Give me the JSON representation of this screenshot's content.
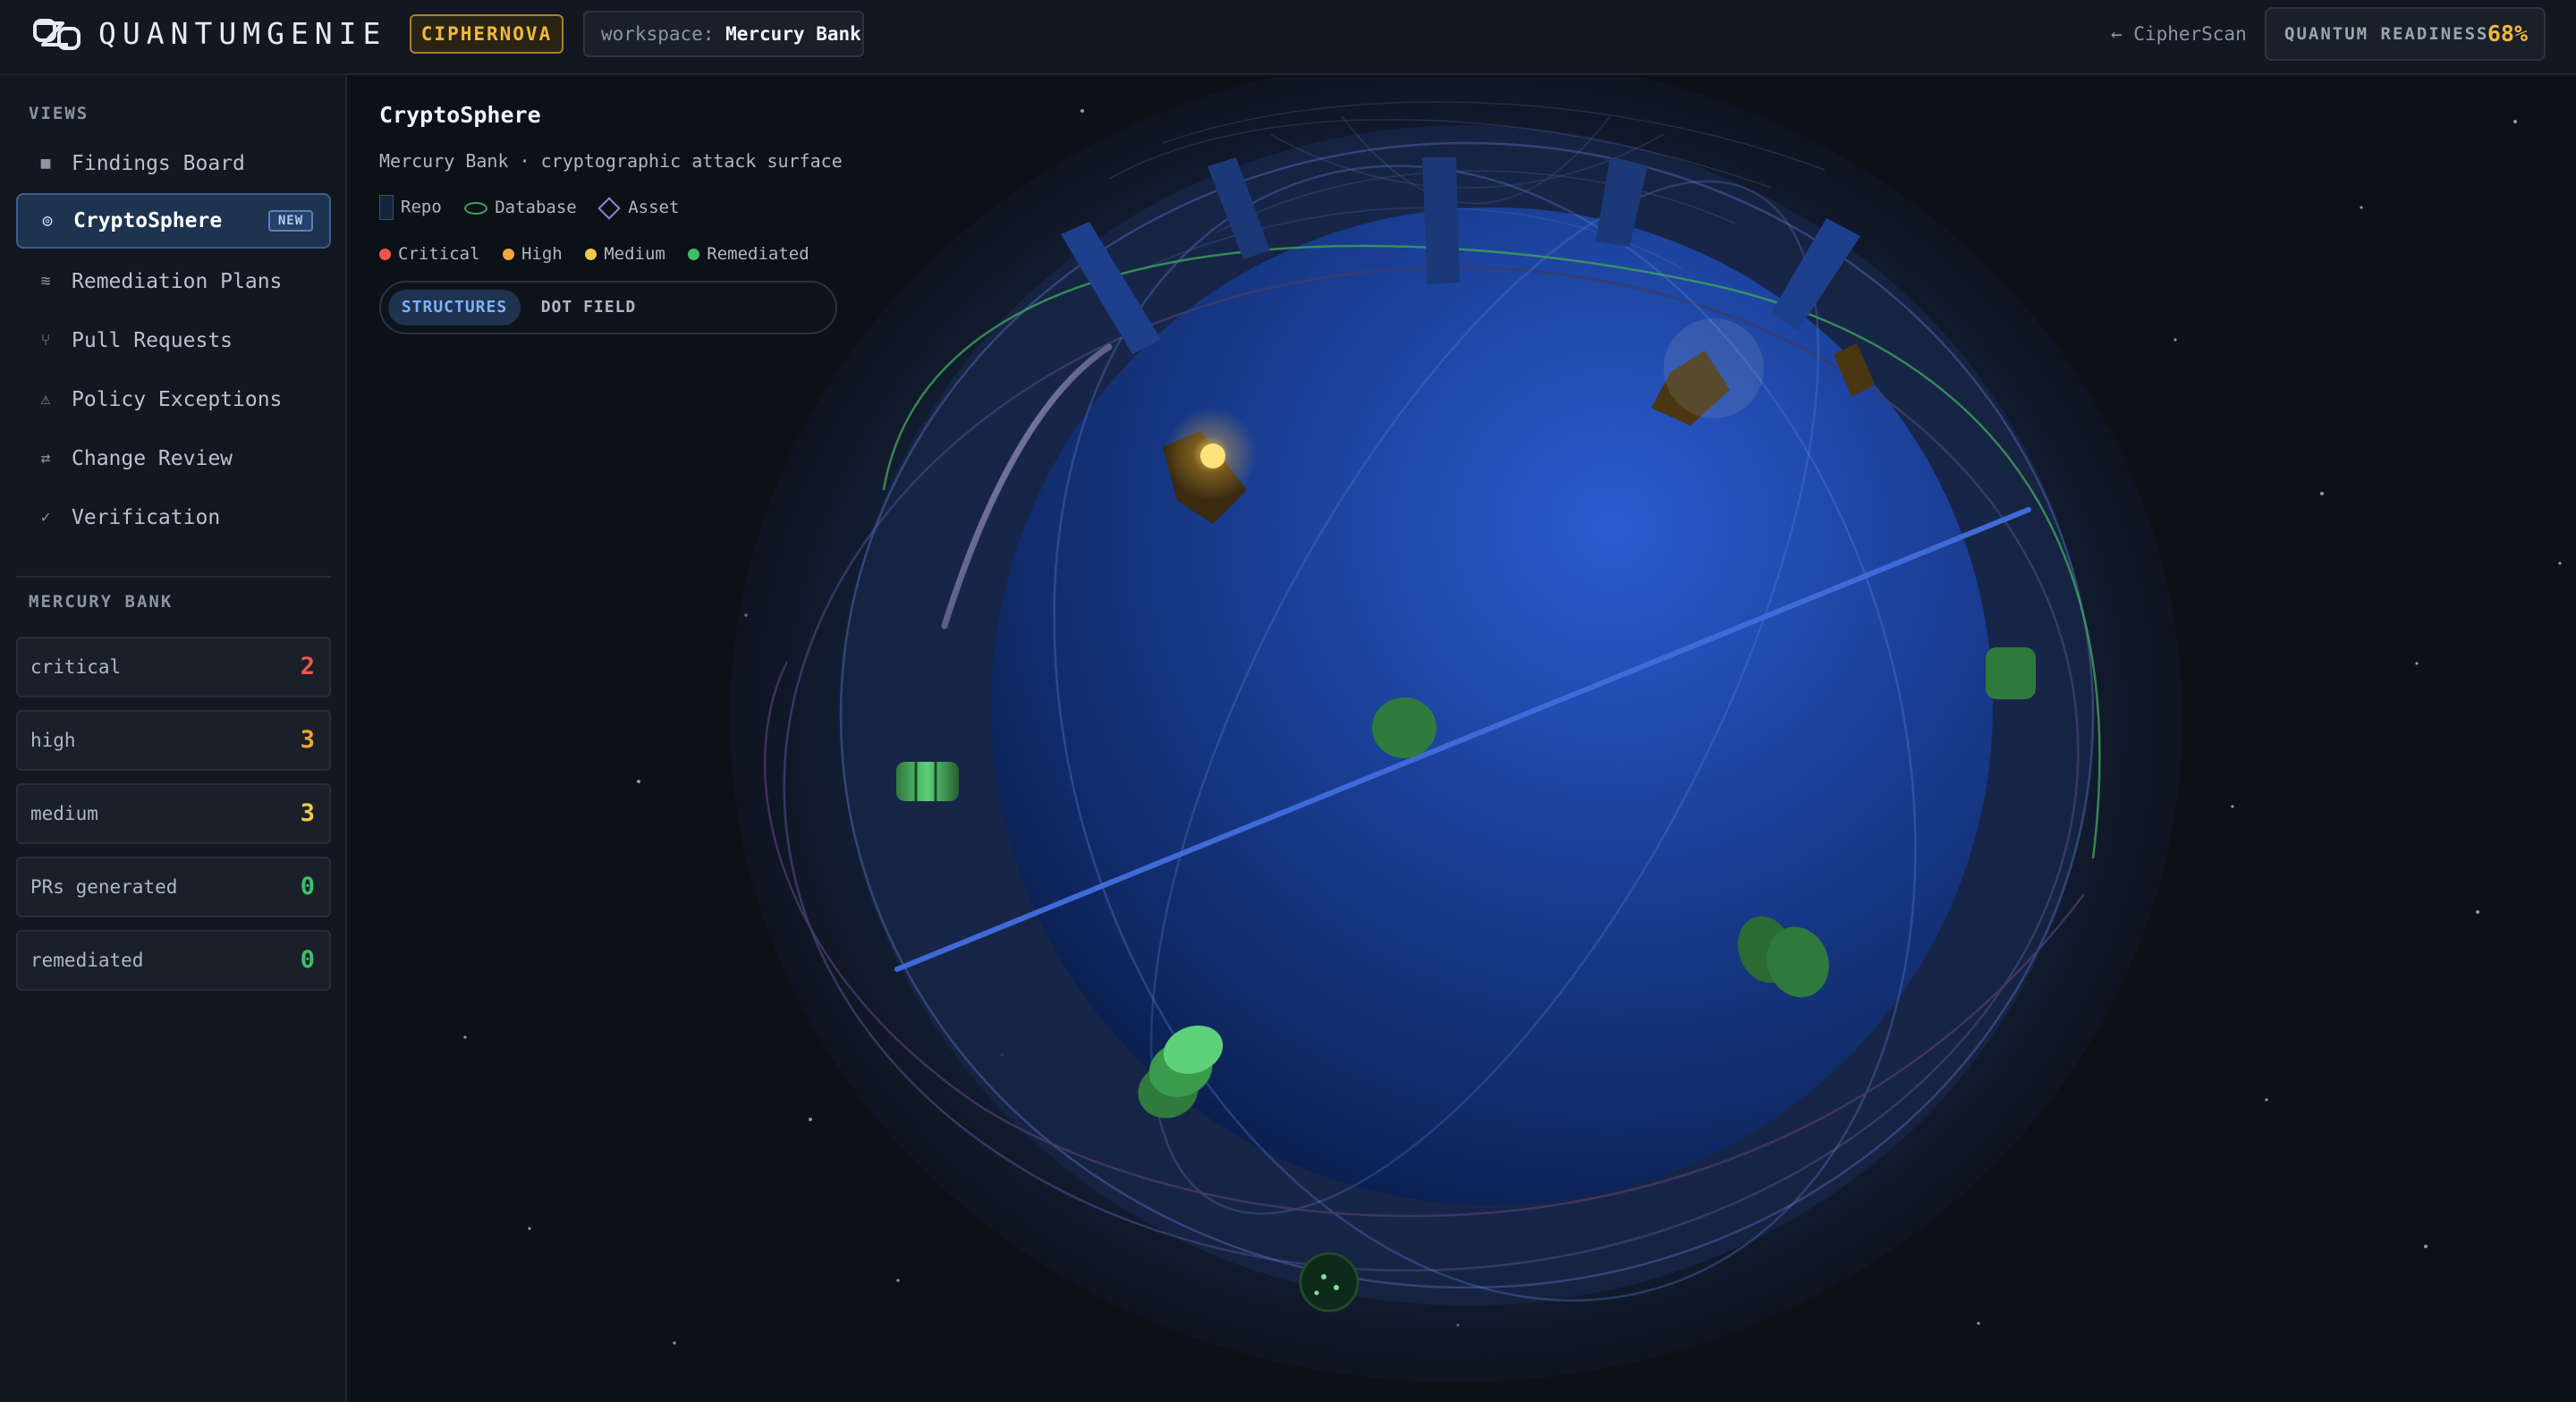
{
  "header": {
    "app_name": "QUANTUMGENIE",
    "brand_badge": "CIPHERNOVA",
    "workspace_label": "workspace:",
    "workspace_name": "Mercury Bank",
    "back_link": "← CipherScan",
    "readiness_label": "QUANTUM READINESS",
    "readiness_value": "68%"
  },
  "sidebar": {
    "views_title": "VIEWS",
    "items": [
      {
        "label": "Findings Board",
        "icon": "grid-square-icon",
        "glyph": "■"
      },
      {
        "label": "CryptoSphere",
        "icon": "target-icon",
        "glyph": "◎",
        "active": true,
        "badge": "NEW"
      },
      {
        "label": "Remediation Plans",
        "icon": "wave-lines-icon",
        "glyph": "≋"
      },
      {
        "label": "Pull Requests",
        "icon": "branch-icon",
        "glyph": "⑂"
      },
      {
        "label": "Policy Exceptions",
        "icon": "warning-icon",
        "glyph": "⚠"
      },
      {
        "label": "Change Review",
        "icon": "swap-arrows-icon",
        "glyph": "⇄"
      },
      {
        "label": "Verification",
        "icon": "check-icon",
        "glyph": "✓"
      }
    ],
    "org_title": "MERCURY BANK",
    "stats": [
      {
        "label": "critical",
        "value": "2",
        "color": "#f0564f"
      },
      {
        "label": "high",
        "value": "3",
        "color": "#f2a33a"
      },
      {
        "label": "medium",
        "value": "3",
        "color": "#f2c94c"
      },
      {
        "label": "PRs generated",
        "value": "0",
        "color": "#3fbf6a"
      },
      {
        "label": "remediated",
        "value": "0",
        "color": "#3fbf6a"
      }
    ]
  },
  "overlay": {
    "title": "CryptoSphere",
    "subtitle": "Mercury Bank · cryptographic attack surface",
    "types": [
      {
        "label": "Repo",
        "shape": "repo"
      },
      {
        "label": "Database",
        "shape": "database"
      },
      {
        "label": "Asset",
        "shape": "asset"
      }
    ],
    "severities": [
      {
        "label": "Critical",
        "color": "#f0564f"
      },
      {
        "label": "High",
        "color": "#f2a33a"
      },
      {
        "label": "Medium",
        "color": "#f2c94c"
      },
      {
        "label": "Remediated",
        "color": "#3fbf6a"
      }
    ],
    "modes": {
      "active": "STRUCTURES",
      "inactive": "DOT FIELD"
    }
  },
  "colors": {
    "accent": "#7fb0ff",
    "brand": "#f2b83a",
    "sphere": "#1f4aa0",
    "background": "#0c1017"
  }
}
